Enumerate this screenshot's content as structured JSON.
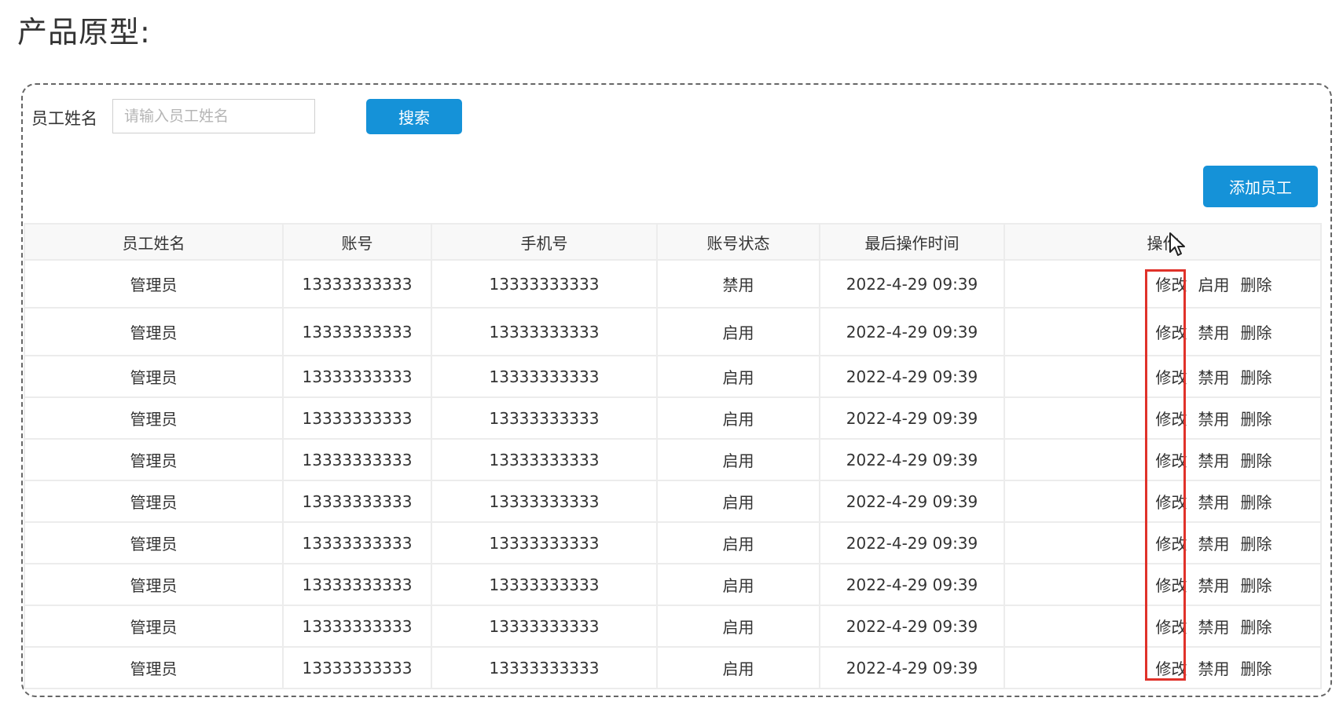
{
  "page": {
    "title": "产品原型:"
  },
  "search": {
    "label": "员工姓名",
    "placeholder": "请输入员工姓名",
    "value": "",
    "button_label": "搜索"
  },
  "toolbar": {
    "add_label": "添加员工"
  },
  "table": {
    "columns": [
      "员工姓名",
      "账号",
      "手机号",
      "账号状态",
      "最后操作时间",
      "操作"
    ],
    "actions": {
      "edit": "修改",
      "delete": "删除"
    },
    "rows": [
      {
        "name": "管理员",
        "account": "13333333333",
        "phone": "13333333333",
        "status": "禁用",
        "time": "2022-4-29 09:39",
        "toggle": "启用"
      },
      {
        "name": "管理员",
        "account": "13333333333",
        "phone": "13333333333",
        "status": "启用",
        "time": "2022-4-29 09:39",
        "toggle": "禁用"
      },
      {
        "name": "管理员",
        "account": "13333333333",
        "phone": "13333333333",
        "status": "启用",
        "time": "2022-4-29 09:39",
        "toggle": "禁用"
      },
      {
        "name": "管理员",
        "account": "13333333333",
        "phone": "13333333333",
        "status": "启用",
        "time": "2022-4-29 09:39",
        "toggle": "禁用"
      },
      {
        "name": "管理员",
        "account": "13333333333",
        "phone": "13333333333",
        "status": "启用",
        "time": "2022-4-29 09:39",
        "toggle": "禁用"
      },
      {
        "name": "管理员",
        "account": "13333333333",
        "phone": "13333333333",
        "status": "启用",
        "time": "2022-4-29 09:39",
        "toggle": "禁用"
      },
      {
        "name": "管理员",
        "account": "13333333333",
        "phone": "13333333333",
        "status": "启用",
        "time": "2022-4-29 09:39",
        "toggle": "禁用"
      },
      {
        "name": "管理员",
        "account": "13333333333",
        "phone": "13333333333",
        "status": "启用",
        "time": "2022-4-29 09:39",
        "toggle": "禁用"
      },
      {
        "name": "管理员",
        "account": "13333333333",
        "phone": "13333333333",
        "status": "启用",
        "time": "2022-4-29 09:39",
        "toggle": "禁用"
      },
      {
        "name": "管理员",
        "account": "13333333333",
        "phone": "13333333333",
        "status": "启用",
        "time": "2022-4-29 09:39",
        "toggle": "禁用"
      }
    ]
  },
  "colors": {
    "accent": "#1592d8",
    "highlight": "#e0322a"
  },
  "icons": {
    "pointer": "mouse-pointer-icon"
  }
}
